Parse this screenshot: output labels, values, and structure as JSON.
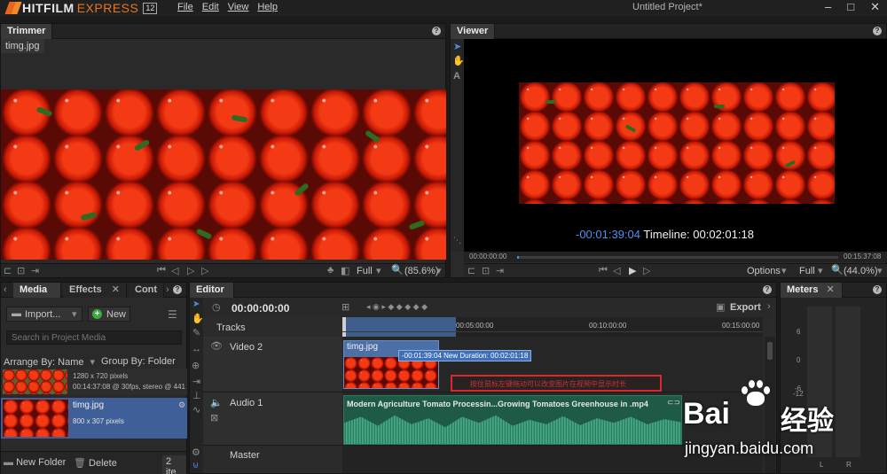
{
  "app": {
    "logo_main": "HITFILM",
    "logo_sub": "EXPRESS",
    "logo_version": "12",
    "menu": [
      "File",
      "Edit",
      "View",
      "Help"
    ],
    "window_title": "Untitled Project*",
    "window_buttons": [
      "–",
      "□",
      "✕"
    ]
  },
  "trimmer": {
    "tab": "Trimmer",
    "file_tab": "timg.jpg",
    "quality": "Full",
    "zoom": "(85.6%)"
  },
  "viewer": {
    "tab": "Viewer",
    "overlay_time": "-00:01:39:04",
    "overlay_label": "Timeline: 00:02:01:18",
    "start_time": "00:00:00:00",
    "end_time": "00:15:37:08",
    "options": "Options",
    "quality": "Full",
    "zoom": "(44.0%)"
  },
  "media": {
    "tabs": [
      "Media",
      "Effects",
      "Cont"
    ],
    "import": "Import...",
    "new": "New",
    "search_placeholder": "Search in Project Media",
    "arrange": "Arrange By: Name",
    "group": "Group By: Folder",
    "items": [
      {
        "name": "",
        "line1": "1280 x 720 pixels",
        "line2": "00:14:37:08 @ 30fps, stereo @ 441"
      },
      {
        "name": "timg.jpg",
        "line1": "800 x 307 pixels",
        "line2": ""
      }
    ],
    "new_folder": "New Folder",
    "delete": "Delete",
    "count": "2 ite"
  },
  "editor": {
    "tab": "Editor",
    "timecode": "00:00:00:00",
    "export": "Export",
    "tracks_label": "Tracks",
    "ruler": [
      "00:05:00:00",
      "00:10:00:00",
      "00:15:00:00"
    ],
    "video_track": "Video 2",
    "audio_track": "Audio 1",
    "master_track": "Master",
    "clip_name": "timg.jpg",
    "tooltip": "-00:01:39:04 New Duration: 00:02:01:18",
    "annotation": "按住鼠标左键拖动可以改变图片在视频中显示时长",
    "audio_clip": "Modern Agriculture Tomato Processin...Growing Tomatoes Greenhouse in .mp4"
  },
  "meters": {
    "tab": "Meters",
    "scale": [
      "6",
      "0",
      "-6",
      "-12",
      "-18",
      "-24"
    ],
    "channels": [
      "L",
      "R"
    ]
  },
  "watermark": {
    "brand": "Bai",
    "brand2": "经验",
    "url": "jingyan.baidu.com"
  }
}
